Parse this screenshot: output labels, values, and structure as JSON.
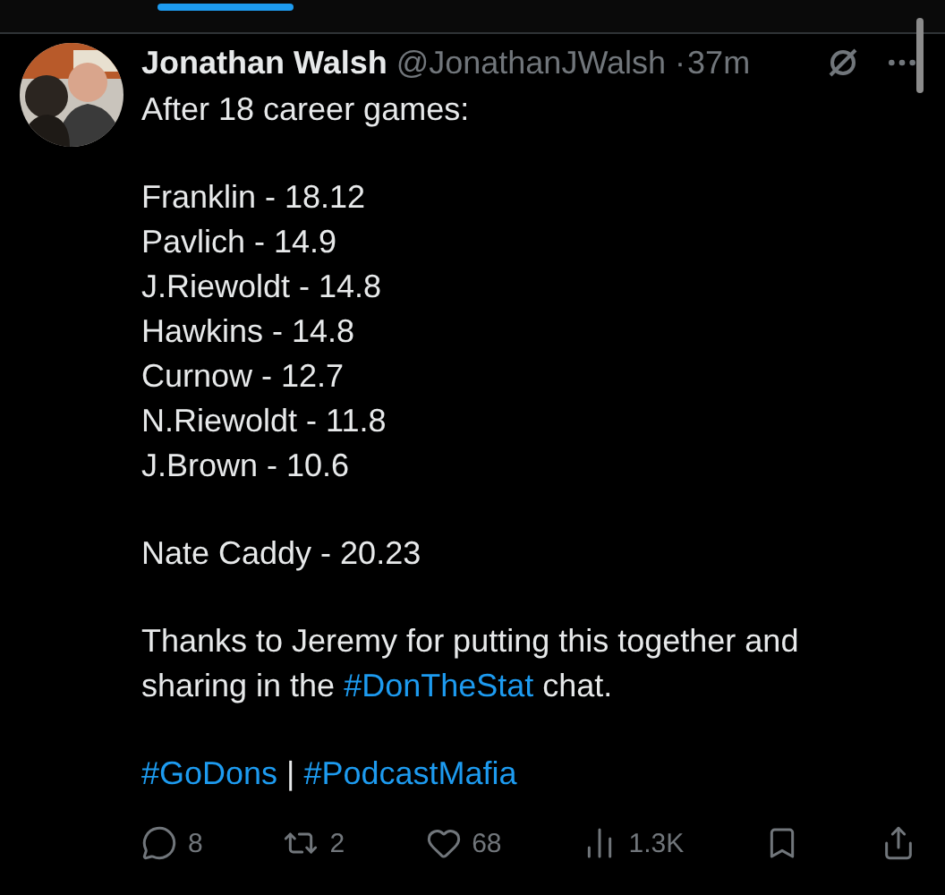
{
  "tweet": {
    "author": "Jonathan Walsh",
    "handle": "@JonathanJWalsh",
    "separator": "·",
    "time": "37m",
    "paragraphs": [
      [
        [
          {
            "kind": "text",
            "text": "After 18 career games:"
          }
        ]
      ],
      [
        [
          {
            "kind": "text",
            "text": "Franklin - 18.12"
          }
        ],
        [
          {
            "kind": "text",
            "text": "Pavlich - 14.9"
          }
        ],
        [
          {
            "kind": "text",
            "text": "J.Riewoldt - 14.8"
          }
        ],
        [
          {
            "kind": "text",
            "text": "Hawkins - 14.8"
          }
        ],
        [
          {
            "kind": "text",
            "text": "Curnow - 12.7"
          }
        ],
        [
          {
            "kind": "text",
            "text": "N.Riewoldt - 11.8"
          }
        ],
        [
          {
            "kind": "text",
            "text": "J.Brown - 10.6"
          }
        ]
      ],
      [
        [
          {
            "kind": "text",
            "text": "Nate Caddy - 20.23"
          }
        ]
      ],
      [
        [
          {
            "kind": "text",
            "text": "Thanks to Jeremy for putting this together and"
          }
        ],
        [
          {
            "kind": "text",
            "text": "sharing in the "
          },
          {
            "kind": "hashtag",
            "text": "#DonTheStat"
          },
          {
            "kind": "text",
            "text": " chat."
          }
        ]
      ],
      [
        [
          {
            "kind": "hashtag",
            "text": "#GoDons"
          },
          {
            "kind": "text",
            "text": " | "
          },
          {
            "kind": "hashtag",
            "text": "#PodcastMafia"
          }
        ]
      ]
    ],
    "actions": [
      {
        "kind": "reply",
        "count": "8"
      },
      {
        "kind": "repost",
        "count": "2"
      },
      {
        "kind": "like",
        "count": "68"
      },
      {
        "kind": "views",
        "count": "1.3K"
      },
      {
        "kind": "bookmark"
      },
      {
        "kind": "share"
      }
    ]
  }
}
